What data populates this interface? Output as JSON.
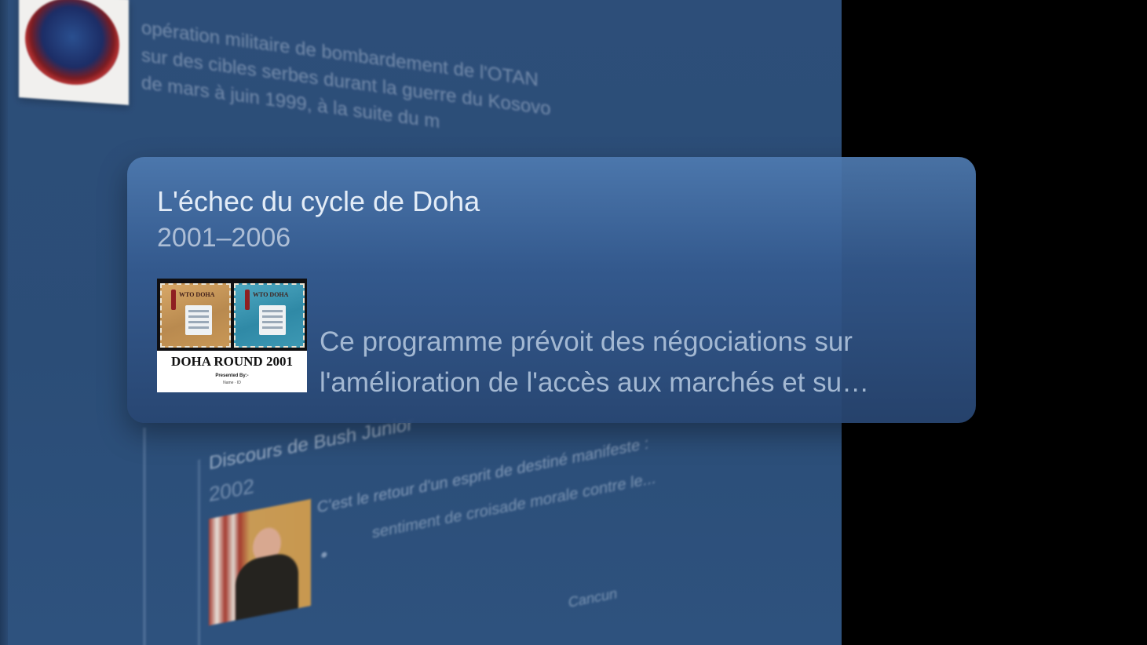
{
  "background": {
    "top_entry": {
      "lines": [
        "opération militaire de bombardement de l'OTAN",
        "sur des cibles serbes durant la guerre du Kosovo",
        "de mars à juin 1999, à la suite du m"
      ]
    },
    "bottom_entry": {
      "title": "Discours de Bush Junior",
      "year": "2002",
      "quote_line1": "C'est le retour d'un esprit de destiné manifeste :",
      "quote_line2": "sentiment de croisade morale contre le...",
      "more": "Cancun"
    }
  },
  "card": {
    "title": "L'échec du cycle de Doha",
    "years": "2001–2006",
    "thumbnail": {
      "stamp_text": "WTO DOHA",
      "caption": "DOHA ROUND 2001",
      "presented": "Presented By:-",
      "presenter_name": "Name",
      "presenter_id": "ID"
    },
    "description": "Ce programme prévoit des négociations sur l'amélioration de l'accès aux marchés et su…"
  }
}
